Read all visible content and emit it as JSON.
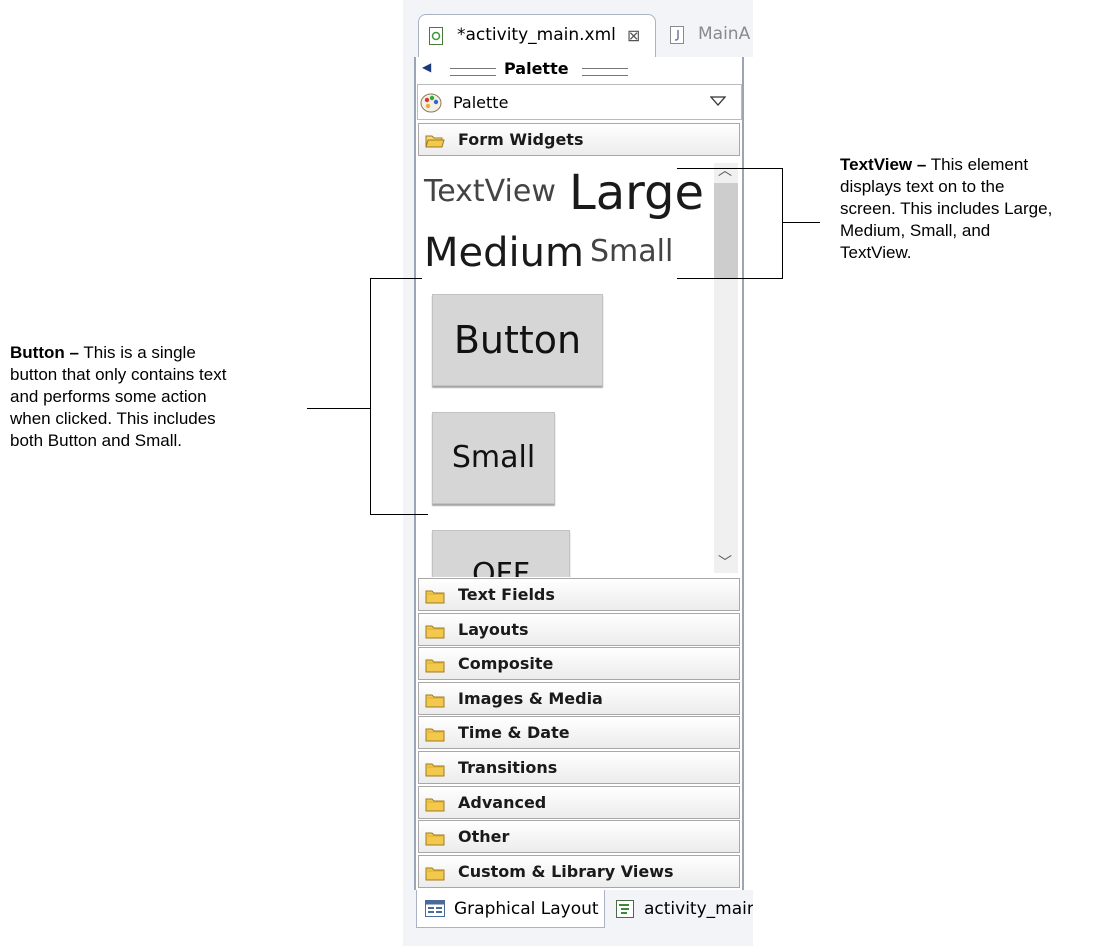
{
  "editor": {
    "active_tab": "*activity_main.xml",
    "second_tab": "MainA"
  },
  "palette": {
    "view_title": "Palette",
    "selector_label": "Palette",
    "expanded_category": "Form Widgets",
    "widgets": {
      "textview": "TextView",
      "large": "Large",
      "medium": "Medium",
      "small_text": "Small",
      "button": "Button",
      "small_button": "Small",
      "toggle": "OFF"
    },
    "categories": [
      "Text Fields",
      "Layouts",
      "Composite",
      "Images & Media",
      "Time & Date",
      "Transitions",
      "Advanced",
      "Other",
      "Custom & Library Views"
    ]
  },
  "bottom_tabs": {
    "graphical": "Graphical Layout",
    "xml": "activity_main"
  },
  "annotations": {
    "textview": {
      "title": "TextView –",
      "lines": [
        "This element",
        "displays text on to the",
        "screen. This includes Large,",
        "Medium, Small, and",
        "TextView."
      ]
    },
    "button": {
      "title": "Button –",
      "lines": [
        "This is a single",
        "button that only contains text",
        "and performs some action",
        "when clicked. This includes",
        "both Button and Small."
      ]
    }
  },
  "colors": {
    "folder": "#f2c94c",
    "widget_button": "#d6d6d6",
    "frame_border": "#9aa6b6"
  }
}
